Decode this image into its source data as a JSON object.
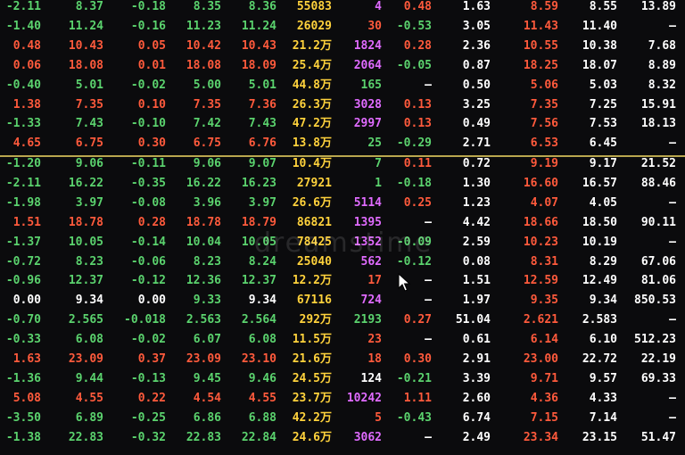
{
  "colors": {
    "up": "#ff5a3c",
    "down": "#5bd36e",
    "neutral": "#ffffff",
    "volume": "#ffd23c",
    "magenta": "#e06bff",
    "background": "#0b0b0d",
    "divider": "#d8c25a"
  },
  "watermark": "dreamstime",
  "icons": {
    "cursor": "mouse-pointer-icon"
  },
  "rows": [
    {
      "cells": [
        "-2.11",
        "8.37",
        "-0.18",
        "8.35",
        "8.36",
        "55083",
        "4",
        "0.48",
        "1.63",
        "8.59",
        "8.55",
        "13.89"
      ],
      "tone": [
        "g",
        "g",
        "g",
        "g",
        "g",
        "y",
        "m",
        "r",
        "w",
        "r",
        "w",
        "w"
      ]
    },
    {
      "cells": [
        "-1.40",
        "11.24",
        "-0.16",
        "11.23",
        "11.24",
        "26029",
        "30",
        "-0.53",
        "3.05",
        "11.43",
        "11.40",
        "—"
      ],
      "tone": [
        "g",
        "g",
        "g",
        "g",
        "g",
        "y",
        "r",
        "g",
        "w",
        "r",
        "w",
        "w"
      ]
    },
    {
      "cells": [
        "0.48",
        "10.43",
        "0.05",
        "10.42",
        "10.43",
        "21.2万",
        "1824",
        "0.28",
        "2.36",
        "10.55",
        "10.38",
        "7.68"
      ],
      "tone": [
        "r",
        "r",
        "r",
        "r",
        "r",
        "y",
        "m",
        "r",
        "w",
        "r",
        "w",
        "w"
      ]
    },
    {
      "cells": [
        "0.06",
        "18.08",
        "0.01",
        "18.08",
        "18.09",
        "25.4万",
        "2064",
        "-0.05",
        "0.87",
        "18.25",
        "18.07",
        "8.89"
      ],
      "tone": [
        "r",
        "r",
        "r",
        "r",
        "r",
        "y",
        "m",
        "g",
        "w",
        "r",
        "w",
        "w"
      ]
    },
    {
      "cells": [
        "-0.40",
        "5.01",
        "-0.02",
        "5.00",
        "5.01",
        "44.8万",
        "165",
        "—",
        "0.50",
        "5.06",
        "5.03",
        "8.32"
      ],
      "tone": [
        "g",
        "g",
        "g",
        "g",
        "g",
        "y",
        "g",
        "w",
        "w",
        "r",
        "w",
        "w"
      ]
    },
    {
      "cells": [
        "1.38",
        "7.35",
        "0.10",
        "7.35",
        "7.36",
        "26.3万",
        "3028",
        "0.13",
        "3.25",
        "7.35",
        "7.25",
        "15.91"
      ],
      "tone": [
        "r",
        "r",
        "r",
        "r",
        "r",
        "y",
        "m",
        "r",
        "w",
        "r",
        "w",
        "w"
      ]
    },
    {
      "cells": [
        "-1.33",
        "7.43",
        "-0.10",
        "7.42",
        "7.43",
        "47.2万",
        "2997",
        "0.13",
        "0.49",
        "7.56",
        "7.53",
        "18.13"
      ],
      "tone": [
        "g",
        "g",
        "g",
        "g",
        "g",
        "y",
        "m",
        "r",
        "w",
        "r",
        "w",
        "w"
      ]
    },
    {
      "cells": [
        "4.65",
        "6.75",
        "0.30",
        "6.75",
        "6.76",
        "13.8万",
        "25",
        "-0.29",
        "2.71",
        "6.53",
        "6.45",
        "—"
      ],
      "tone": [
        "r",
        "r",
        "r",
        "r",
        "r",
        "y",
        "g",
        "g",
        "w",
        "r",
        "w",
        "w"
      ]
    },
    {
      "cells": [
        "-1.20",
        "9.06",
        "-0.11",
        "9.06",
        "9.07",
        "10.4万",
        "7",
        "0.11",
        "0.72",
        "9.19",
        "9.17",
        "21.52"
      ],
      "tone": [
        "g",
        "g",
        "g",
        "g",
        "g",
        "y",
        "g",
        "r",
        "w",
        "r",
        "w",
        "w"
      ]
    },
    {
      "cells": [
        "-2.11",
        "16.22",
        "-0.35",
        "16.22",
        "16.23",
        "27921",
        "1",
        "-0.18",
        "1.30",
        "16.60",
        "16.57",
        "88.46"
      ],
      "tone": [
        "g",
        "g",
        "g",
        "g",
        "g",
        "y",
        "g",
        "g",
        "w",
        "r",
        "w",
        "w"
      ]
    },
    {
      "cells": [
        "-1.98",
        "3.97",
        "-0.08",
        "3.96",
        "3.97",
        "26.6万",
        "5114",
        "0.25",
        "1.23",
        "4.07",
        "4.05",
        "—"
      ],
      "tone": [
        "g",
        "g",
        "g",
        "g",
        "g",
        "y",
        "m",
        "r",
        "w",
        "r",
        "w",
        "w"
      ]
    },
    {
      "cells": [
        "1.51",
        "18.78",
        "0.28",
        "18.78",
        "18.79",
        "86821",
        "1395",
        "—",
        "4.42",
        "18.66",
        "18.50",
        "90.11"
      ],
      "tone": [
        "r",
        "r",
        "r",
        "r",
        "r",
        "y",
        "m",
        "w",
        "w",
        "r",
        "w",
        "w"
      ]
    },
    {
      "cells": [
        "-1.37",
        "10.05",
        "-0.14",
        "10.04",
        "10.05",
        "78425",
        "1352",
        "-0.09",
        "2.59",
        "10.23",
        "10.19",
        "—"
      ],
      "tone": [
        "g",
        "g",
        "g",
        "g",
        "g",
        "y",
        "m",
        "g",
        "w",
        "r",
        "w",
        "w"
      ]
    },
    {
      "cells": [
        "-0.72",
        "8.23",
        "-0.06",
        "8.23",
        "8.24",
        "25040",
        "562",
        "-0.12",
        "0.08",
        "8.31",
        "8.29",
        "67.06"
      ],
      "tone": [
        "g",
        "g",
        "g",
        "g",
        "g",
        "y",
        "m",
        "g",
        "w",
        "r",
        "w",
        "w"
      ]
    },
    {
      "cells": [
        "-0.96",
        "12.37",
        "-0.12",
        "12.36",
        "12.37",
        "12.2万",
        "17",
        "—",
        "1.51",
        "12.59",
        "12.49",
        "81.06"
      ],
      "tone": [
        "g",
        "g",
        "g",
        "g",
        "g",
        "y",
        "r",
        "w",
        "w",
        "r",
        "w",
        "w"
      ]
    },
    {
      "cells": [
        "0.00",
        "9.34",
        "0.00",
        "9.33",
        "9.34",
        "67116",
        "724",
        "—",
        "1.97",
        "9.35",
        "9.34",
        "850.53"
      ],
      "tone": [
        "w",
        "w",
        "w",
        "g",
        "w",
        "y",
        "m",
        "w",
        "w",
        "r",
        "w",
        "w"
      ]
    },
    {
      "cells": [
        "-0.70",
        "2.565",
        "-0.018",
        "2.563",
        "2.564",
        "292万",
        "2193",
        "0.27",
        "51.04",
        "2.621",
        "2.583",
        "—"
      ],
      "tone": [
        "g",
        "g",
        "g",
        "g",
        "g",
        "y",
        "g",
        "r",
        "w",
        "r",
        "w",
        "w"
      ]
    },
    {
      "cells": [
        "-0.33",
        "6.08",
        "-0.02",
        "6.07",
        "6.08",
        "11.5万",
        "23",
        "—",
        "0.61",
        "6.14",
        "6.10",
        "512.23"
      ],
      "tone": [
        "g",
        "g",
        "g",
        "g",
        "g",
        "y",
        "r",
        "w",
        "w",
        "r",
        "w",
        "w"
      ]
    },
    {
      "cells": [
        "1.63",
        "23.09",
        "0.37",
        "23.09",
        "23.10",
        "21.6万",
        "18",
        "0.30",
        "2.91",
        "23.00",
        "22.72",
        "22.19"
      ],
      "tone": [
        "r",
        "r",
        "r",
        "r",
        "r",
        "y",
        "r",
        "r",
        "w",
        "r",
        "w",
        "w"
      ]
    },
    {
      "cells": [
        "-1.36",
        "9.44",
        "-0.13",
        "9.45",
        "9.46",
        "24.5万",
        "124",
        "-0.21",
        "3.39",
        "9.71",
        "9.57",
        "69.33"
      ],
      "tone": [
        "g",
        "g",
        "g",
        "g",
        "g",
        "y",
        "w",
        "g",
        "w",
        "r",
        "w",
        "w"
      ]
    },
    {
      "cells": [
        "5.08",
        "4.55",
        "0.22",
        "4.54",
        "4.55",
        "23.7万",
        "10242",
        "1.11",
        "2.60",
        "4.36",
        "4.33",
        "—"
      ],
      "tone": [
        "r",
        "r",
        "r",
        "r",
        "r",
        "y",
        "m",
        "r",
        "w",
        "r",
        "w",
        "w"
      ]
    },
    {
      "cells": [
        "-3.50",
        "6.89",
        "-0.25",
        "6.86",
        "6.88",
        "42.2万",
        "5",
        "-0.43",
        "6.74",
        "7.15",
        "7.14",
        "—"
      ],
      "tone": [
        "g",
        "g",
        "g",
        "g",
        "g",
        "y",
        "r",
        "g",
        "w",
        "r",
        "w",
        "w"
      ]
    },
    {
      "cells": [
        "-1.38",
        "22.83",
        "-0.32",
        "22.83",
        "22.84",
        "24.6万",
        "3062",
        "—",
        "2.49",
        "23.34",
        "23.15",
        "51.47"
      ],
      "tone": [
        "g",
        "g",
        "g",
        "g",
        "g",
        "y",
        "m",
        "w",
        "w",
        "r",
        "w",
        "w"
      ]
    }
  ]
}
